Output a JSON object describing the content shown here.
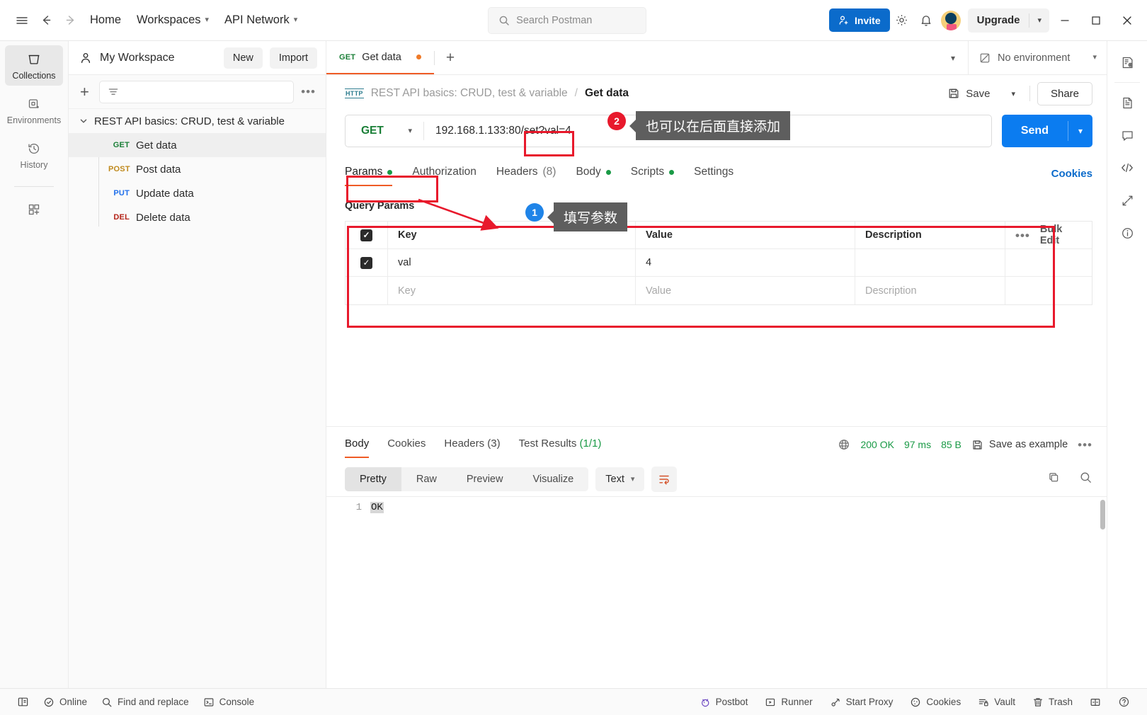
{
  "topbar": {
    "hamburger_icon": "menu-icon",
    "back_icon": "arrow-left-icon",
    "forward_icon": "arrow-right-icon",
    "home_label": "Home",
    "workspaces_label": "Workspaces",
    "api_network_label": "API Network",
    "search_placeholder": "Search Postman",
    "invite_label": "Invite",
    "settings_icon": "gear-icon",
    "notifications_icon": "bell-icon",
    "avatar_icon": "avatar",
    "upgrade_label": "Upgrade",
    "minimize_icon": "minimize-icon",
    "maximize_icon": "maximize-icon",
    "close_icon": "close-icon"
  },
  "rail": {
    "items": [
      {
        "label": "Collections",
        "icon": "collections-icon",
        "active": true
      },
      {
        "label": "Environments",
        "icon": "environments-icon",
        "active": false
      },
      {
        "label": "History",
        "icon": "history-icon",
        "active": false
      }
    ],
    "add_label": "",
    "add_icon": "add-module-icon"
  },
  "workspace": {
    "name": "My Workspace",
    "user_icon": "person-icon",
    "new_label": "New",
    "import_label": "Import",
    "add_icon": "plus-icon",
    "filter_icon": "filter-icon",
    "more_icon": "more-options-icon"
  },
  "collections": {
    "name": "REST API basics: CRUD, test & variable",
    "expanded": true,
    "requests": [
      {
        "method": "GET",
        "name": "Get data",
        "selected": true
      },
      {
        "method": "POST",
        "name": "Post data",
        "selected": false
      },
      {
        "method": "PUT",
        "name": "Update data",
        "selected": false
      },
      {
        "method": "DEL",
        "name": "Delete data",
        "selected": false
      }
    ]
  },
  "tabbar": {
    "tabs": [
      {
        "method": "GET",
        "name": "Get data",
        "unsaved": true,
        "active": true
      }
    ],
    "new_tab_icon": "plus-icon",
    "tab_list_caret_icon": "chevron-down-icon",
    "environment_label": "No environment",
    "environment_icon": "no-environment-icon"
  },
  "request": {
    "protocol_badge": "HTTP",
    "breadcrumb_collection": "REST API basics: CRUD, test & variable",
    "breadcrumb_sep": "/",
    "breadcrumb_request": "Get data",
    "save_label": "Save",
    "save_icon": "save-icon",
    "share_label": "Share",
    "method": "GET",
    "url": "192.168.1.133:80/set?val=4",
    "url_prefix": "192.168.1.133:80/",
    "url_highlight": "set?val=4",
    "send_label": "Send",
    "tabs": [
      {
        "label": "Params",
        "dot": true,
        "count": "",
        "active": true
      },
      {
        "label": "Authorization",
        "dot": false,
        "count": "",
        "active": false
      },
      {
        "label": "Headers",
        "dot": false,
        "count": "(8)",
        "active": false
      },
      {
        "label": "Body",
        "dot": true,
        "count": "",
        "active": false
      },
      {
        "label": "Scripts",
        "dot": true,
        "count": "",
        "active": false
      },
      {
        "label": "Settings",
        "dot": false,
        "count": "",
        "active": false
      }
    ],
    "cookies_label": "Cookies"
  },
  "params": {
    "section_title": "Query Params",
    "headers": [
      "Key",
      "Value",
      "Description"
    ],
    "bulk_edit_label": "Bulk Edit",
    "more_icon": "more-options-icon",
    "rows": [
      {
        "checked": true,
        "key": "val",
        "value": "4",
        "description": "",
        "placeholder": false
      },
      {
        "checked": false,
        "key": "Key",
        "value": "Value",
        "description": "Description",
        "placeholder": true
      }
    ]
  },
  "response": {
    "tabs": [
      {
        "label": "Body",
        "count": "",
        "active": true
      },
      {
        "label": "Cookies",
        "count": "",
        "active": false
      },
      {
        "label": "Headers",
        "count": "(3)",
        "active": false
      },
      {
        "label": "Test Results",
        "count": "(1/1)",
        "active": false
      }
    ],
    "globe_icon": "globe-icon",
    "status": "200 OK",
    "time": "97 ms",
    "size": "85 B",
    "save_example_label": "Save as example",
    "save_example_icon": "save-icon",
    "more_icon": "more-options-icon",
    "format_pills": [
      {
        "label": "Pretty",
        "active": true
      },
      {
        "label": "Raw",
        "active": false
      },
      {
        "label": "Preview",
        "active": false
      },
      {
        "label": "Visualize",
        "active": false
      }
    ],
    "content_type": "Text",
    "wrap_icon": "wrap-lines-icon",
    "copy_icon": "copy-icon",
    "search_icon": "search-icon",
    "body_lines": [
      {
        "number": "1",
        "text": "OK"
      }
    ]
  },
  "right_rail": {
    "items": [
      {
        "icon": "documentation-preview-icon"
      },
      {
        "icon": "documentation-icon"
      },
      {
        "icon": "comments-icon"
      },
      {
        "icon": "code-snippet-icon"
      },
      {
        "icon": "fork-changes-icon"
      },
      {
        "icon": "info-icon"
      }
    ]
  },
  "statusbar": {
    "left": [
      {
        "label": "",
        "icon": "sidebar-toggle-icon"
      },
      {
        "label": "Online",
        "icon": "check-circle-icon"
      },
      {
        "label": "Find and replace",
        "icon": "search-icon"
      },
      {
        "label": "Console",
        "icon": "console-icon"
      }
    ],
    "right": [
      {
        "label": "Postbot",
        "icon": "postbot-icon"
      },
      {
        "label": "Runner",
        "icon": "runner-icon"
      },
      {
        "label": "Start Proxy",
        "icon": "proxy-icon"
      },
      {
        "label": "Cookies",
        "icon": "cookie-icon"
      },
      {
        "label": "Vault",
        "icon": "vault-icon"
      },
      {
        "label": "Trash",
        "icon": "trash-icon"
      },
      {
        "label": "",
        "icon": "layout-icon"
      },
      {
        "label": "",
        "icon": "help-icon"
      }
    ]
  },
  "annotations": {
    "step1": {
      "badge": "1",
      "text": "填写参数",
      "color": "#1f84e8"
    },
    "step2": {
      "badge": "2",
      "text": "也可以在后面直接添加",
      "color": "#e8192c"
    },
    "highlight_color": "#e8192c"
  }
}
